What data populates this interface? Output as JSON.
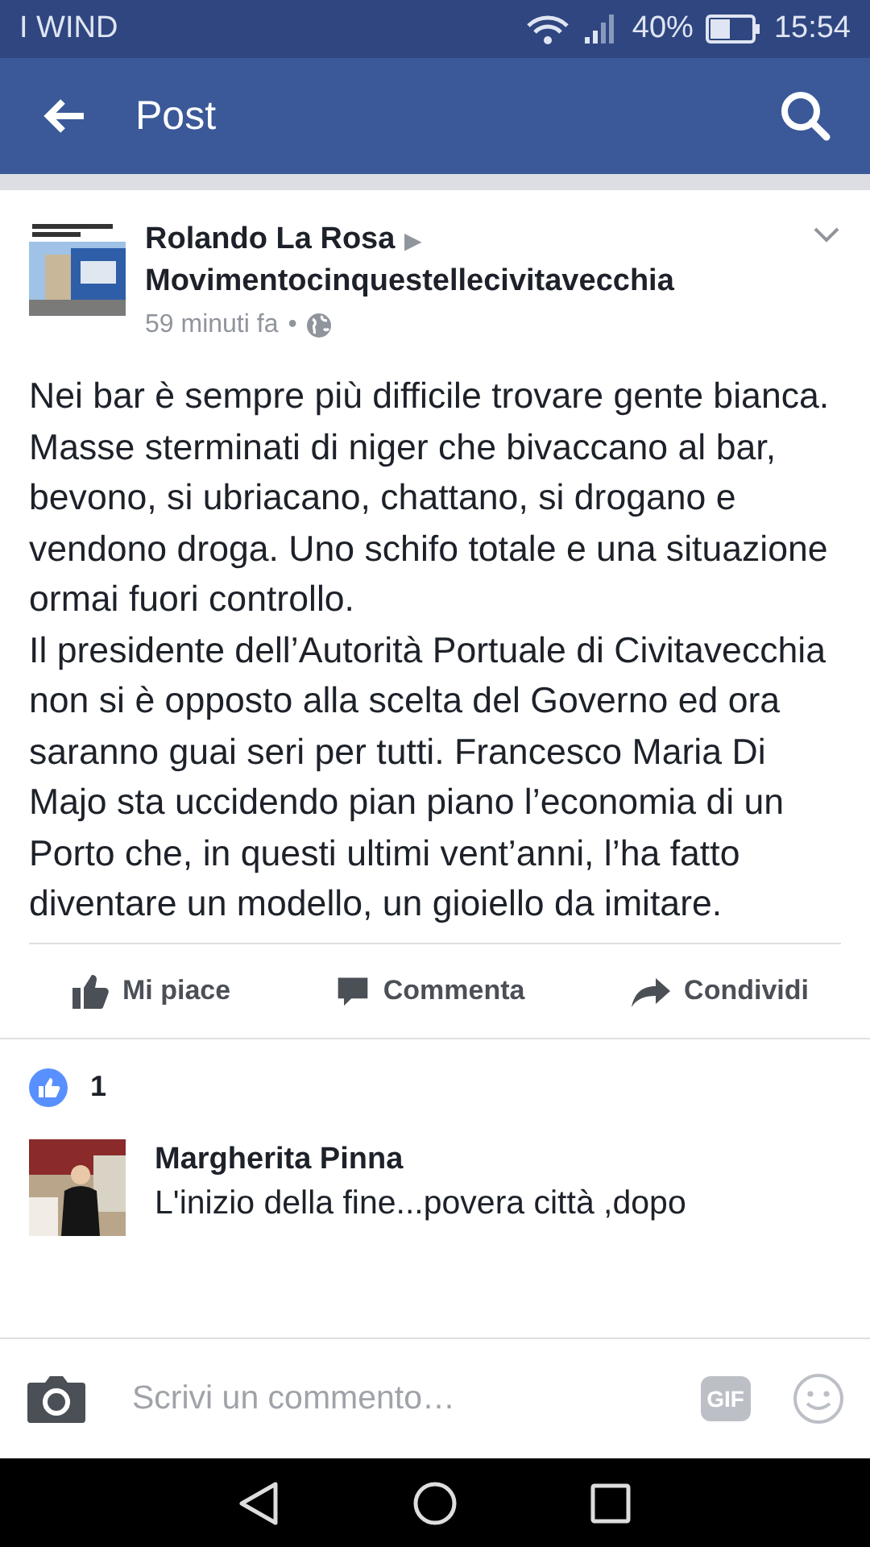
{
  "status_bar": {
    "carrier": "I WIND",
    "battery": "40%",
    "time": "15:54"
  },
  "app_bar": {
    "title": "Post"
  },
  "post": {
    "author": "Rolando La Rosa",
    "arrow": "▶",
    "page": "Movimentocinquestellecivitavecchia",
    "time": "59 minuti fa",
    "separator": "•",
    "paragraphs": [
      "Nei bar è sempre più difficile trovare gente bianca. Masse sterminati di niger che bivaccano al bar, bevono, si ubriacano, chattano, si drogano e vendono droga. Uno schifo totale e una situazione ormai fuori controllo.",
      "Il presidente dell’Autorità Portuale di Civitavecchia non si è opposto alla scelta del Governo ed ora saranno guai seri per tutti. Francesco Maria Di Majo sta uccidendo pian piano l’economia di un Porto che, in questi ultimi vent’anni, l’ha fatto diventare un modello, un gioiello da imitare."
    ],
    "actions": [
      {
        "kind": "like",
        "label": "Mi piace"
      },
      {
        "kind": "comment",
        "label": "Commenta"
      },
      {
        "kind": "share",
        "label": "Condividi"
      }
    ],
    "like_count": "1"
  },
  "comments": [
    {
      "author": "Margherita Pinna",
      "text": "L'inizio della fine...povera città ,dopo"
    }
  ],
  "composer": {
    "placeholder": "Scrivi un commento…",
    "gif": "GIF"
  }
}
